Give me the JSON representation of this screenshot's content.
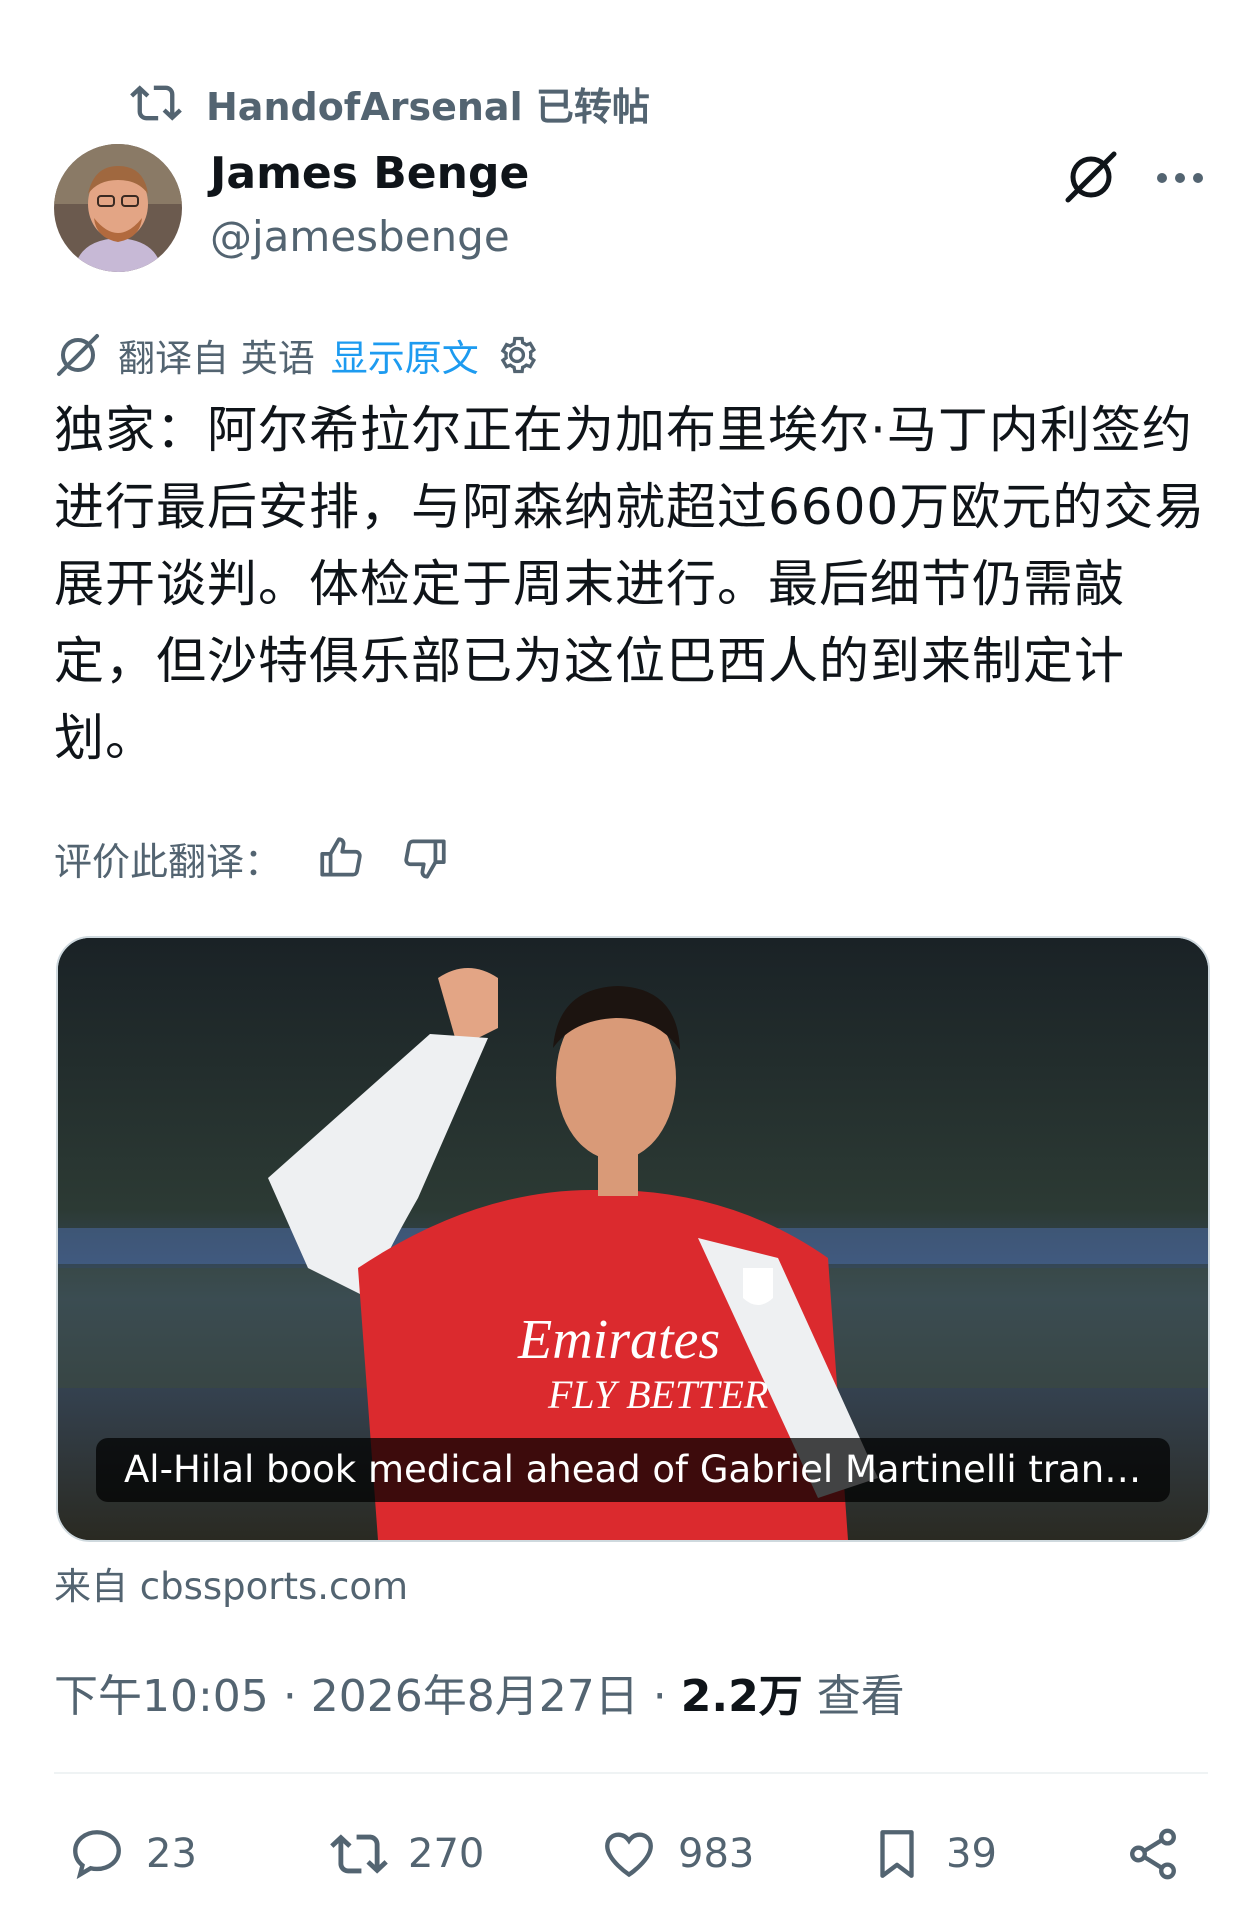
{
  "retweet": {
    "icon": "retweet-icon",
    "text": "HandofArsenal 已转帖"
  },
  "author": {
    "name": "James Benge",
    "handle": "@jamesbenge",
    "avatar": "avatar-photo"
  },
  "header_icons": {
    "grok": "grok-icon",
    "more": "more-icon"
  },
  "translation": {
    "label": "翻译自 英语",
    "show_original": "显示原文",
    "settings_icon": "gear-icon"
  },
  "tweet_text": "独家：阿尔希拉尔正在为加布里埃尔·马丁内利签约进行最后安排，与阿森纳就超过6600万欧元的交易展开谈判。体检定于周末进行。最后细节仍需敲定，但沙特俱乐部已为这位巴西人的到来制定计划。",
  "rate": {
    "label": "评价此翻译：",
    "up_icon": "thumbs-up-icon",
    "down_icon": "thumbs-down-icon"
  },
  "card": {
    "caption": "Al-Hilal book medical ahead of Gabriel Martinelli tran…",
    "source": "来自 cbssports.com",
    "shirt_brand": "Emirates",
    "shirt_slogan": "FLY BETTER"
  },
  "meta": {
    "time": "下午10:05",
    "date": "2026年8月27日",
    "views_count": "2.2万",
    "views_label": "查看"
  },
  "actions": {
    "replies": "23",
    "reposts": "270",
    "likes": "983",
    "bookmarks": "39"
  },
  "colors": {
    "accent": "#1d9bf0",
    "secondary_text": "#536471",
    "arsenal_red": "#db2a2e"
  }
}
